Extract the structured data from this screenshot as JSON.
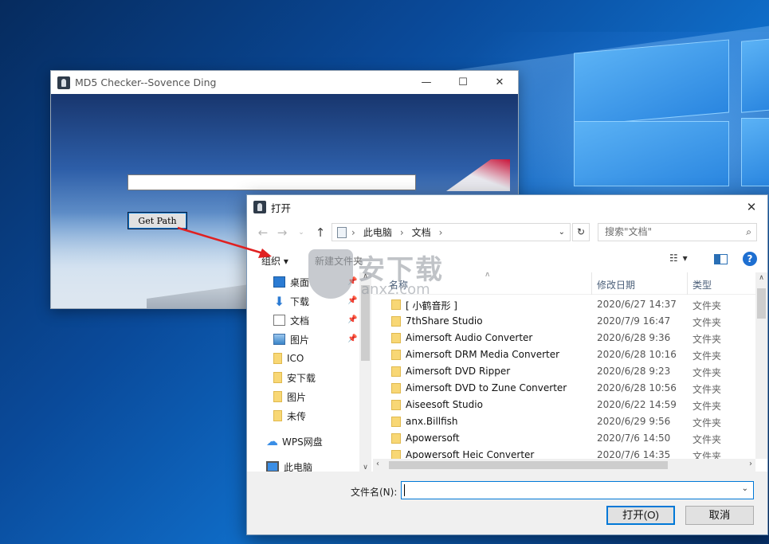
{
  "desktop": {},
  "md5_window": {
    "title": "MD5 Checker--Sovence Ding",
    "path_value": "",
    "get_path_label": "Get Path"
  },
  "dialog": {
    "title": "打开",
    "breadcrumbs": [
      "此电脑",
      "文档"
    ],
    "search_placeholder": "搜索\"文档\"",
    "organize_label": "组织 ▾",
    "new_folder_label": "新建文件夹",
    "nav_items": [
      {
        "label": "桌面",
        "icon": "desktop-icon",
        "pinned": true
      },
      {
        "label": "下载",
        "icon": "download-icon",
        "pinned": true
      },
      {
        "label": "文档",
        "icon": "document-icon",
        "pinned": true
      },
      {
        "label": "图片",
        "icon": "picture-icon",
        "pinned": true
      },
      {
        "label": "ICO",
        "icon": "folder-icon",
        "pinned": false
      },
      {
        "label": "安下载",
        "icon": "folder-icon",
        "pinned": false
      },
      {
        "label": "图片",
        "icon": "folder-icon",
        "pinned": false
      },
      {
        "label": "未传",
        "icon": "folder-icon",
        "pinned": false
      },
      {
        "label": "WPS网盘",
        "icon": "cloud-icon",
        "pinned": false
      },
      {
        "label": "此电脑",
        "icon": "computer-icon",
        "pinned": false
      }
    ],
    "columns": {
      "name": "名称",
      "date": "修改日期",
      "type": "类型"
    },
    "files": [
      {
        "name": "[ 小鹤音形 ]",
        "date": "2020/6/27 14:37",
        "type": "文件夹"
      },
      {
        "name": "7thShare Studio",
        "date": "2020/7/9 16:47",
        "type": "文件夹"
      },
      {
        "name": "Aimersoft Audio Converter",
        "date": "2020/6/28 9:36",
        "type": "文件夹"
      },
      {
        "name": "Aimersoft DRM Media Converter",
        "date": "2020/6/28 10:16",
        "type": "文件夹"
      },
      {
        "name": "Aimersoft DVD Ripper",
        "date": "2020/6/28 9:23",
        "type": "文件夹"
      },
      {
        "name": "Aimersoft DVD to Zune Converter",
        "date": "2020/6/28 10:56",
        "type": "文件夹"
      },
      {
        "name": "Aiseesoft Studio",
        "date": "2020/6/22 14:59",
        "type": "文件夹"
      },
      {
        "name": "anx.Billfish",
        "date": "2020/6/29 9:56",
        "type": "文件夹"
      },
      {
        "name": "Apowersoft",
        "date": "2020/7/6 14:50",
        "type": "文件夹"
      },
      {
        "name": "Apowersoft Heic Converter",
        "date": "2020/7/6 14:35",
        "type": "文件夹"
      }
    ],
    "filename_label": "文件名(N):",
    "filename_value": "",
    "open_label": "打开(O)",
    "cancel_label": "取消"
  },
  "watermark": {
    "big": "安下载",
    "small": "anxz.com"
  },
  "colors": {
    "accent": "#0078d7",
    "arrow": "#e02020",
    "folder": "#f8d775"
  }
}
